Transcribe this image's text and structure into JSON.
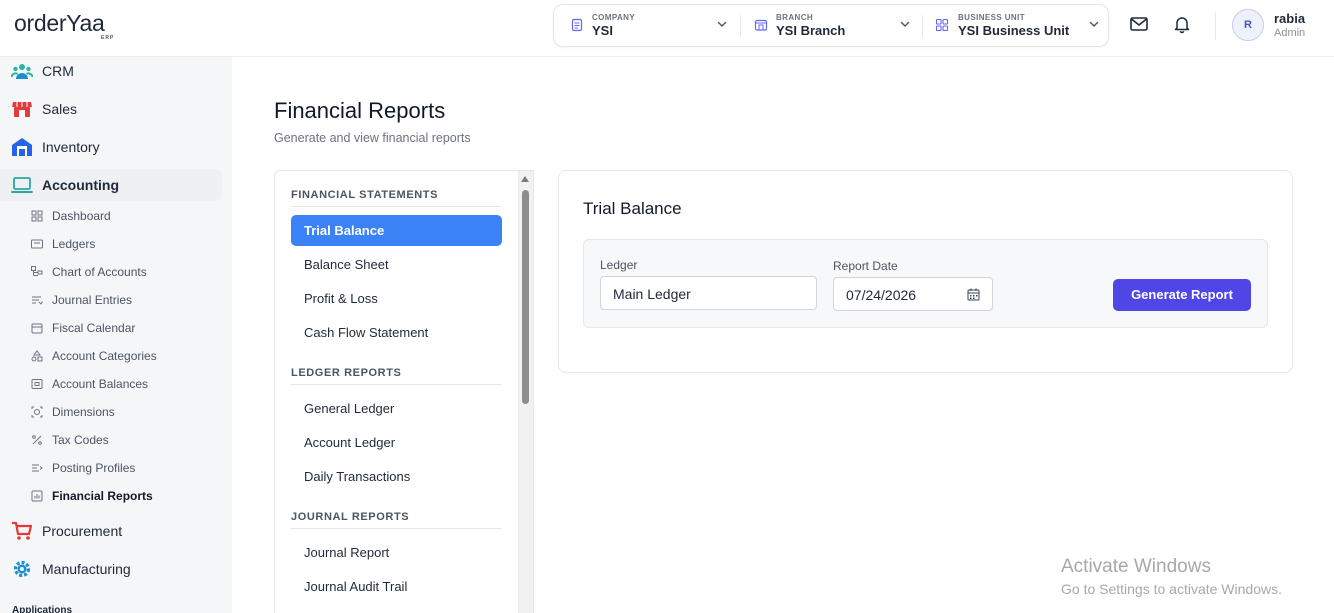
{
  "header": {
    "logo_text": "orderYaa",
    "logo_sub": "ERP",
    "company": {
      "caption": "COMPANY",
      "value": "YSI"
    },
    "branch": {
      "caption": "BRANCH",
      "value": "YSI Branch"
    },
    "business_unit": {
      "caption": "BUSINESS UNIT",
      "value": "YSI Business Unit"
    },
    "user": {
      "initial": "R",
      "name": "rabia",
      "role": "Admin"
    }
  },
  "sidebar": {
    "modules": [
      {
        "label": "CRM",
        "icon": "crm-icon",
        "color": "#2bb3a3"
      },
      {
        "label": "Sales",
        "icon": "sales-store-icon",
        "color": "#e23b3b"
      },
      {
        "label": "Inventory",
        "icon": "inventory-warehouse-icon",
        "color": "#2563eb"
      },
      {
        "label": "Accounting",
        "icon": "accounting-laptop-icon",
        "color": "#2aa8a0"
      }
    ],
    "accounting_items": [
      {
        "label": "Dashboard",
        "icon": "dashboard-grid-icon"
      },
      {
        "label": "Ledgers",
        "icon": "ledgers-card-icon"
      },
      {
        "label": "Chart of Accounts",
        "icon": "chart-of-accounts-hierarchy-icon"
      },
      {
        "label": "Journal Entries",
        "icon": "journal-lines-icon"
      },
      {
        "label": "Fiscal Calendar",
        "icon": "calendar-icon"
      },
      {
        "label": "Account Categories",
        "icon": "categories-shapes-icon"
      },
      {
        "label": "Account Balances",
        "icon": "balance-icon"
      },
      {
        "label": "Dimensions",
        "icon": "dimensions-target-icon"
      },
      {
        "label": "Tax Codes",
        "icon": "percent-icon"
      },
      {
        "label": "Posting Profiles",
        "icon": "posting-list-icon"
      },
      {
        "label": "Financial Reports",
        "icon": "report-chart-icon"
      }
    ],
    "modules_after": [
      {
        "label": "Procurement",
        "icon": "procurement-cart-icon",
        "color": "#e23b3b"
      },
      {
        "label": "Manufacturing",
        "icon": "manufacturing-gear-icon",
        "color": "#1d8fd1"
      }
    ],
    "apps_label": "Applications"
  },
  "page": {
    "title": "Financial Reports",
    "subtitle": "Generate and view financial reports"
  },
  "report_list": {
    "sections": [
      {
        "title": "FINANCIAL STATEMENTS",
        "items": [
          "Trial Balance",
          "Balance Sheet",
          "Profit & Loss",
          "Cash Flow Statement"
        ]
      },
      {
        "title": "LEDGER REPORTS",
        "items": [
          "General Ledger",
          "Account Ledger",
          "Daily Transactions"
        ]
      },
      {
        "title": "JOURNAL REPORTS",
        "items": [
          "Journal Report",
          "Journal Audit Trail"
        ]
      }
    ],
    "active": "Trial Balance"
  },
  "report_card": {
    "title": "Trial Balance",
    "ledger_label": "Ledger",
    "ledger_value": "Main Ledger",
    "date_label": "Report Date",
    "date_value": "07/24/2026",
    "generate_label": "Generate Report",
    "button_color": "#4f46e5"
  },
  "watermark": {
    "line1": "Activate Windows",
    "line2": "Go to Settings to activate Windows."
  }
}
